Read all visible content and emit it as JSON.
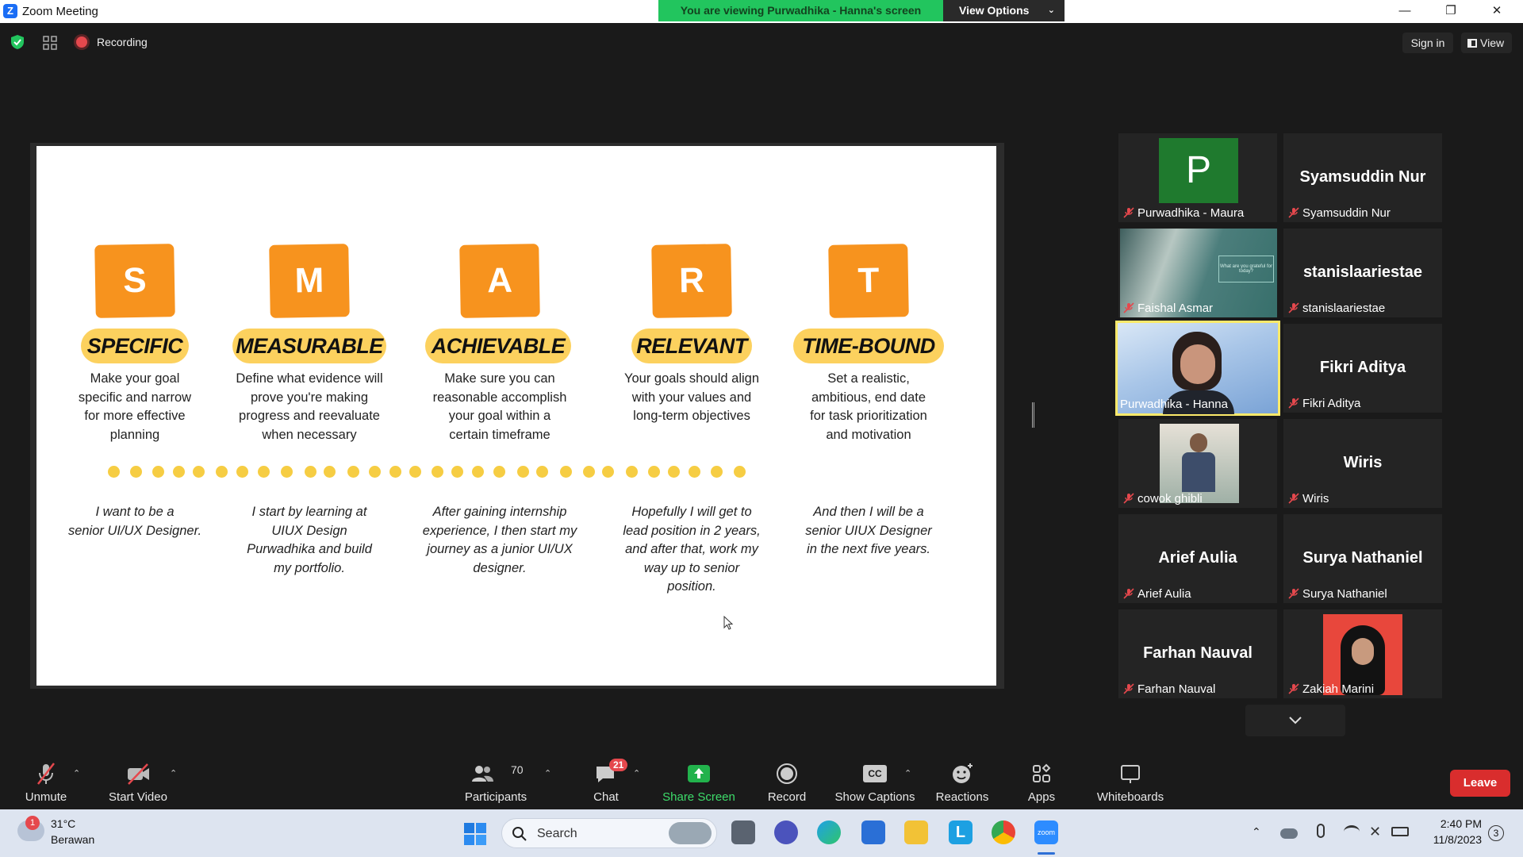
{
  "window": {
    "title": "Zoom Meeting",
    "banner": "You are viewing Purwadhika - Hanna's screen",
    "view_options": "View Options",
    "minimize": "—",
    "restore": "❐",
    "close": "✕"
  },
  "topbar": {
    "recording_label": "Recording",
    "sign_in": "Sign in",
    "view": "View"
  },
  "slide": {
    "cards": [
      {
        "letter": "S",
        "title": "SPECIFIC",
        "desc": [
          "Make your goal",
          "specific and narrow",
          "for more effective",
          "planning"
        ],
        "story": [
          "I want to be a",
          "senior UI/UX Designer."
        ]
      },
      {
        "letter": "M",
        "title": "MEASURABLE",
        "desc": [
          "Define what evidence will",
          "prove you're making",
          "progress and reevaluate",
          "when necessary"
        ],
        "story": [
          "I start by learning at",
          "UIUX Design",
          "Purwadhika and build",
          "my portfolio."
        ]
      },
      {
        "letter": "A",
        "title": "ACHIEVABLE",
        "desc": [
          "Make sure you can",
          "reasonable accomplish",
          "your goal within a",
          "certain timeframe"
        ],
        "story": [
          "After gaining internship",
          "experience, I then start my",
          "journey as a junior UI/UX",
          "designer."
        ]
      },
      {
        "letter": "R",
        "title": "RELEVANT",
        "desc": [
          "Your goals should align",
          "with your values and",
          "long-term objectives"
        ],
        "story": [
          "Hopefully I will get to",
          "lead position in 2 years,",
          "and after that, work my",
          "way up to senior",
          "position."
        ]
      },
      {
        "letter": "T",
        "title": "TIME-BOUND",
        "desc": [
          "Set a realistic,",
          "ambitious,  end date",
          "for task prioritization",
          "and motivation"
        ],
        "story": [
          "And then I will be a",
          "senior UIUX Designer",
          "in the next five years."
        ]
      }
    ]
  },
  "gallery": {
    "tiles": [
      {
        "label": "Purwadhika - Maura",
        "big": "",
        "avatar_letter": "P"
      },
      {
        "label": "Syamsuddin Nur",
        "big": "Syamsuddin Nur"
      },
      {
        "label": "Faishal Asmar",
        "big": ""
      },
      {
        "label": "stanislaariestae",
        "big": "stanislaariestae"
      },
      {
        "label": "Purwadhika - Hanna",
        "big": ""
      },
      {
        "label": "Fikri Aditya",
        "big": "Fikri Aditya"
      },
      {
        "label": "cowok ghibli",
        "big": ""
      },
      {
        "label": "Wiris",
        "big": "Wiris"
      },
      {
        "label": "Arief Aulia",
        "big": "Arief Aulia"
      },
      {
        "label": "Surya Nathaniel",
        "big": "Surya Nathaniel"
      },
      {
        "label": "Farhan Nauval",
        "big": "Farhan Nauval"
      },
      {
        "label": "Zakiah Marini",
        "big": ""
      }
    ],
    "faishal_screen_text": "What are you grateful for today?"
  },
  "toolbar": {
    "unmute": "Unmute",
    "start_video": "Start Video",
    "participants": "Participants",
    "participants_count": "70",
    "chat": "Chat",
    "chat_badge": "21",
    "share_screen": "Share Screen",
    "record": "Record",
    "show_captions": "Show Captions",
    "captions_icon": "CC",
    "reactions": "Reactions",
    "apps": "Apps",
    "whiteboards": "Whiteboards",
    "leave": "Leave"
  },
  "taskbar": {
    "temperature": "31°C",
    "weather": "Berawan",
    "weather_badge": "1",
    "search": "Search",
    "time": "2:40 PM",
    "date": "11/8/2023",
    "notif_count": "3"
  },
  "colors": {
    "accent_orange": "#f7931e",
    "pill_yellow": "#fcd15e",
    "banner_green": "#22c55e",
    "leave_red": "#d92d2d"
  }
}
